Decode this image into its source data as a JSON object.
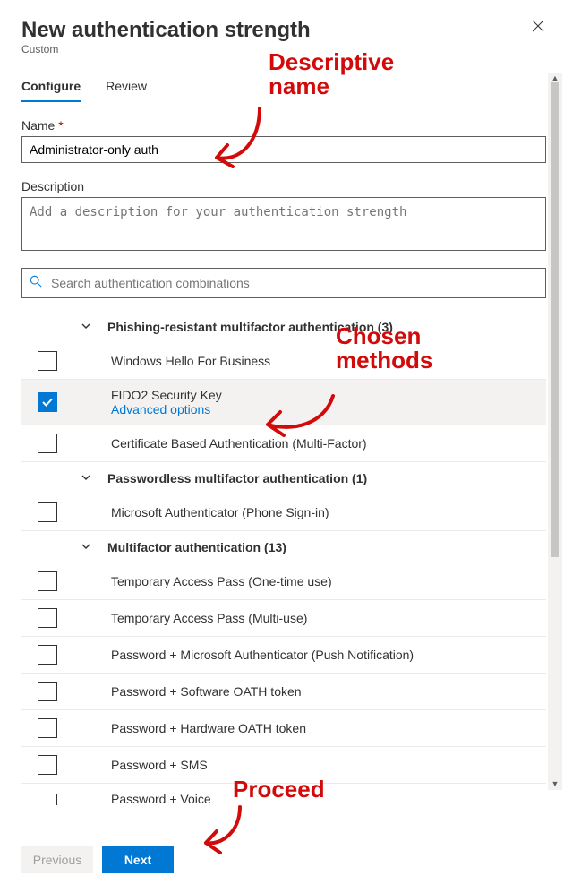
{
  "header": {
    "title": "New authentication strength",
    "subtitle": "Custom"
  },
  "tabs": {
    "configure": "Configure",
    "review": "Review"
  },
  "name_field": {
    "label": "Name",
    "value": "Administrator-only auth"
  },
  "desc_field": {
    "label": "Description",
    "placeholder": "Add a description for your authentication strength"
  },
  "search": {
    "placeholder": "Search authentication combinations"
  },
  "groups": [
    {
      "title": "Phishing-resistant multifactor authentication",
      "count": 3
    },
    {
      "title": "Passwordless multifactor authentication",
      "count": 1
    },
    {
      "title": "Multifactor authentication",
      "count": 13
    }
  ],
  "methods_g0": [
    {
      "label": "Windows Hello For Business",
      "checked": false
    },
    {
      "label": "FIDO2 Security Key",
      "checked": true,
      "advanced": "Advanced options"
    },
    {
      "label": "Certificate Based Authentication (Multi-Factor)",
      "checked": false
    }
  ],
  "methods_g1": [
    {
      "label": "Microsoft Authenticator (Phone Sign-in)",
      "checked": false
    }
  ],
  "methods_g2": [
    {
      "label": "Temporary Access Pass (One-time use)",
      "checked": false
    },
    {
      "label": "Temporary Access Pass (Multi-use)",
      "checked": false
    },
    {
      "label": "Password + Microsoft Authenticator (Push Notification)",
      "checked": false
    },
    {
      "label": "Password + Software OATH token",
      "checked": false
    },
    {
      "label": "Password + Hardware OATH token",
      "checked": false
    },
    {
      "label": "Password + SMS",
      "checked": false
    },
    {
      "label": "Password + Voice",
      "checked": false
    }
  ],
  "footer": {
    "previous": "Previous",
    "next": "Next"
  },
  "annotations": {
    "a1": "Descriptive name",
    "a2": "Chosen methods",
    "a3": "Proceed"
  }
}
